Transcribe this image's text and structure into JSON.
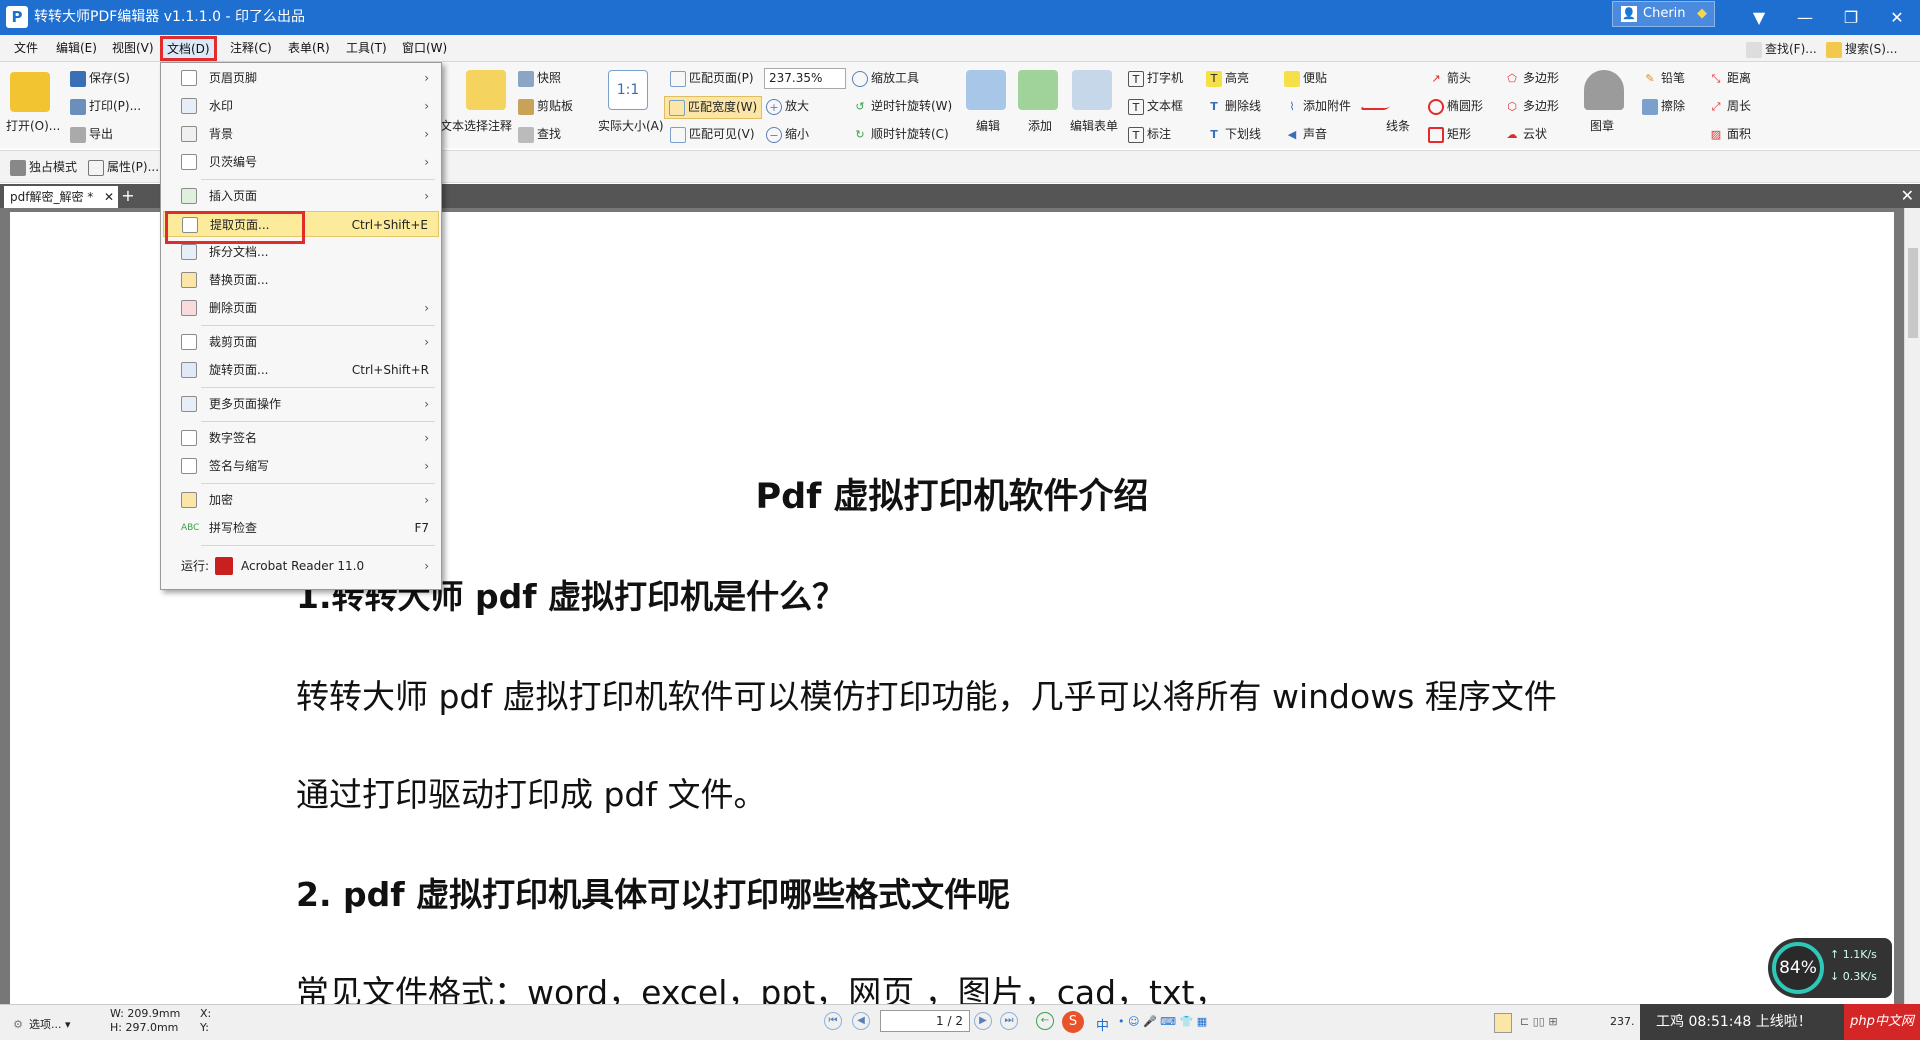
{
  "window": {
    "title": "转转大师PDF编辑器 v1.1.1.0 - 印了么出品",
    "user": "Cherin"
  },
  "menubar": {
    "items": [
      "文件",
      "编辑(E)",
      "视图(V)",
      "文档(D)",
      "注释(C)",
      "表单(R)",
      "工具(T)",
      "窗口(W)"
    ],
    "search": "查找(F)...",
    "search2": "搜索(S)..."
  },
  "toolbar": {
    "open": "打开(O)...",
    "save": "保存(S)",
    "print": "打印(P)...",
    "export": "导出",
    "snapshot": "快照",
    "clipboard": "剪贴板",
    "find": "查找",
    "text": "文本",
    "select_comment": "选择注释",
    "actual_size": "实际大小(A)",
    "fit_page": "匹配页面(P)",
    "fit_width": "匹配宽度(W)",
    "fit_visible": "匹配可见(V)",
    "zoom_value": "237.35%",
    "zoom_tool": "缩放工具",
    "zoom_in": "放大",
    "zoom_out": "缩小",
    "rotate_ccw": "逆时针旋转(W)",
    "rotate_cw": "顺时针旋转(C)",
    "edit": "编辑",
    "add": "添加",
    "edit_form": "编辑表单",
    "typewriter": "打字机",
    "textbox": "文本框",
    "callout": "标注",
    "highlight": "高亮",
    "strikeout": "删除线",
    "underline": "下划线",
    "note": "便贴",
    "attach": "添加附件",
    "sound": "声音",
    "line": "线条",
    "arrow": "箭头",
    "ellipse": "椭圆形",
    "rect": "矩形",
    "polygon": "多边形",
    "polyline": "多边形",
    "cloud": "云状",
    "stamp": "图章",
    "pencil": "铅笔",
    "eraser": "擦除",
    "distance": "距离",
    "perimeter": "周长",
    "area": "面积",
    "exclusive": "独占模式",
    "properties": "属性(P)..."
  },
  "tab": {
    "name": "pdf解密_解密 *"
  },
  "dropdown": {
    "items": [
      {
        "label": "页眉页脚",
        "shortcut": "",
        "arrow": "›"
      },
      {
        "label": "水印",
        "shortcut": "",
        "arrow": "›"
      },
      {
        "label": "背景",
        "shortcut": "",
        "arrow": "›"
      },
      {
        "label": "贝茨编号",
        "shortcut": "",
        "arrow": "›"
      },
      {
        "label": "插入页面",
        "shortcut": "",
        "arrow": "›"
      },
      {
        "label": "提取页面...",
        "shortcut": "Ctrl+Shift+E",
        "arrow": ""
      },
      {
        "label": "拆分文档...",
        "shortcut": "",
        "arrow": ""
      },
      {
        "label": "替换页面...",
        "shortcut": "",
        "arrow": ""
      },
      {
        "label": "删除页面",
        "shortcut": "",
        "arrow": "›"
      },
      {
        "label": "裁剪页面",
        "shortcut": "",
        "arrow": "›"
      },
      {
        "label": "旋转页面...",
        "shortcut": "Ctrl+Shift+R",
        "arrow": ""
      },
      {
        "label": "更多页面操作",
        "shortcut": "",
        "arrow": "›"
      },
      {
        "label": "数字签名",
        "shortcut": "",
        "arrow": "›"
      },
      {
        "label": "签名与缩写",
        "shortcut": "",
        "arrow": "›"
      },
      {
        "label": "加密",
        "shortcut": "",
        "arrow": "›"
      },
      {
        "label": "拼写检查",
        "shortcut": "F7",
        "arrow": ""
      }
    ],
    "run_label": "运行:",
    "run_app": "Acrobat Reader 11.0"
  },
  "document": {
    "title": "Pdf 虚拟打印机软件介绍",
    "h1": "1.转转大师 pdf 虚拟打印机是什么？",
    "p1": "转转大师 pdf 虚拟打印机软件可以模仿打印功能，几乎可以将所有 windows 程序文件",
    "p2": "通过打印驱动打印成 pdf 文件。",
    "h2": "2.  pdf 虚拟打印机具体可以打印哪些格式文件呢",
    "p3": "常见文件格式：word，excel，ppt，网页  ，图片，cad，txt，"
  },
  "status": {
    "options": "选项...",
    "w": "W: 209.9mm",
    "h": "H: 297.0mm",
    "x": "X:",
    "y": "Y:",
    "page": "1 / 2",
    "zoom": "237.",
    "ime": "中",
    "perf_percent": "84%",
    "up_speed": "1.1K/s",
    "down_speed": "0.3K/s",
    "notice": "工鸡  08:51:48 上线啦！",
    "brand": "php中文网"
  },
  "colors": {
    "titlebar": "#1e6fd0",
    "highlight_red": "#e22b2b",
    "menu_hover": "#fdeb9c"
  }
}
